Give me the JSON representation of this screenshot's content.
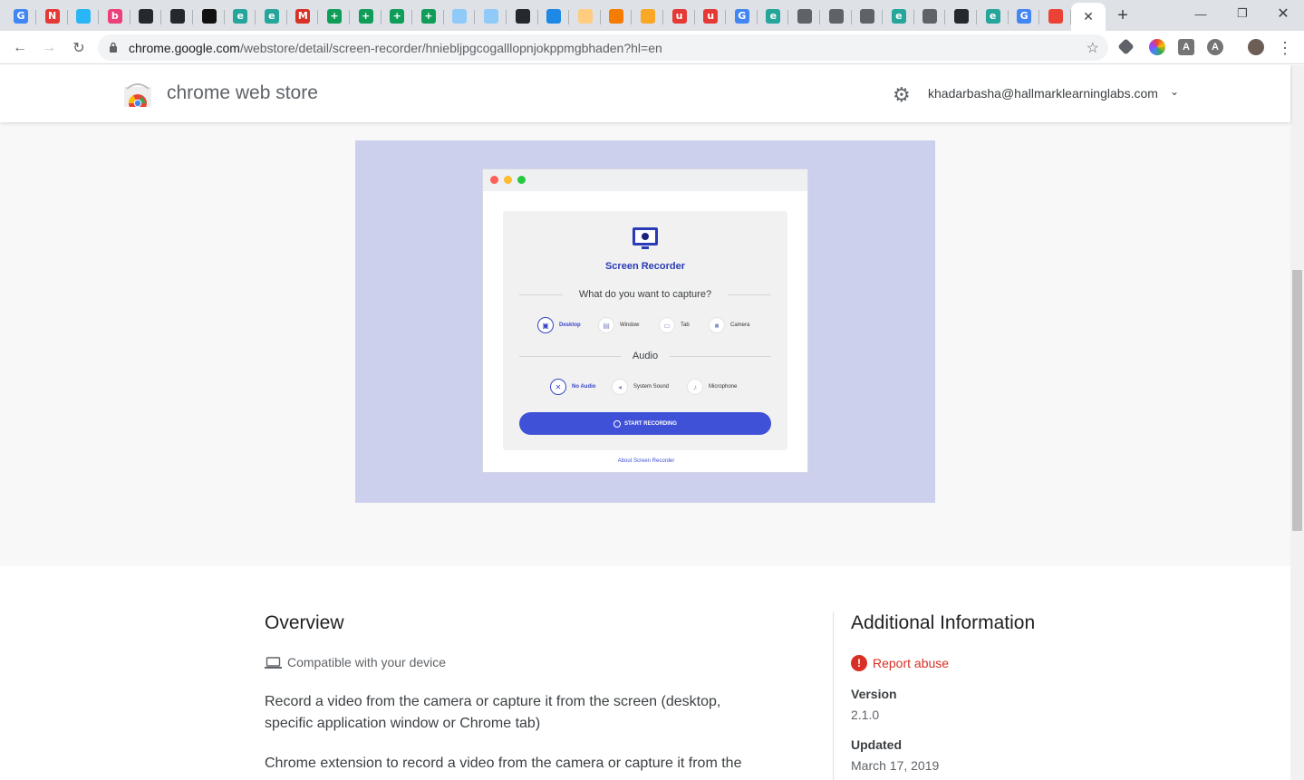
{
  "browser": {
    "tabs": [
      {
        "icon": "google-icon",
        "letter": "G",
        "color": "#4285f4"
      },
      {
        "icon": "n-icon",
        "letter": "N",
        "color": "#e53935"
      },
      {
        "icon": "pie-icon",
        "letter": "",
        "color": "#29b6f6"
      },
      {
        "icon": "b-icon",
        "letter": "b",
        "color": "#ec407a"
      },
      {
        "icon": "github-icon",
        "letter": "",
        "color": "#24292e"
      },
      {
        "icon": "github-icon",
        "letter": "",
        "color": "#24292e"
      },
      {
        "icon": "terminal-icon",
        "letter": "",
        "color": "#111111"
      },
      {
        "icon": "edu-icon",
        "letter": "e",
        "color": "#26a69a"
      },
      {
        "icon": "edu-icon",
        "letter": "e",
        "color": "#26a69a"
      },
      {
        "icon": "gmail-icon",
        "letter": "M",
        "color": "#d93025"
      },
      {
        "icon": "sheets-icon",
        "letter": "+",
        "color": "#0f9d58"
      },
      {
        "icon": "sheets-icon",
        "letter": "+",
        "color": "#0f9d58"
      },
      {
        "icon": "sheets-icon",
        "letter": "+",
        "color": "#0f9d58"
      },
      {
        "icon": "sheets-icon",
        "letter": "+",
        "color": "#0f9d58"
      },
      {
        "icon": "circle-icon",
        "letter": "",
        "color": "#90caf9"
      },
      {
        "icon": "circle-icon",
        "letter": "",
        "color": "#90caf9"
      },
      {
        "icon": "github-icon",
        "letter": "",
        "color": "#24292e"
      },
      {
        "icon": "person-icon",
        "letter": "",
        "color": "#1e88e5"
      },
      {
        "icon": "doc-icon",
        "letter": "",
        "color": "#ffcc80"
      },
      {
        "icon": "box-icon",
        "letter": "",
        "color": "#f57c00"
      },
      {
        "icon": "pma-icon",
        "letter": "",
        "color": "#f9a825"
      },
      {
        "icon": "u-icon",
        "letter": "u",
        "color": "#e53935"
      },
      {
        "icon": "u-icon",
        "letter": "u",
        "color": "#e53935"
      },
      {
        "icon": "translate-icon",
        "letter": "G",
        "color": "#4285f4"
      },
      {
        "icon": "edu-icon",
        "letter": "e",
        "color": "#26a69a"
      },
      {
        "icon": "globe-icon",
        "letter": "",
        "color": "#5f6368"
      },
      {
        "icon": "globe-icon",
        "letter": "",
        "color": "#5f6368"
      },
      {
        "icon": "globe-icon",
        "letter": "",
        "color": "#5f6368"
      },
      {
        "icon": "edu-icon",
        "letter": "e",
        "color": "#26a69a"
      },
      {
        "icon": "globe-icon",
        "letter": "",
        "color": "#5f6368"
      },
      {
        "icon": "github-icon",
        "letter": "",
        "color": "#24292e"
      },
      {
        "icon": "edu-icon",
        "letter": "e",
        "color": "#26a69a"
      },
      {
        "icon": "google-icon",
        "letter": "G",
        "color": "#4285f4"
      },
      {
        "icon": "webstore-icon",
        "letter": "",
        "color": "#ea4335"
      }
    ],
    "url_host": "chrome.google.com",
    "url_path": "/webstore/detail/screen-recorder/hnieblјpgcogalllopnjokppmgbhaden?hl=en"
  },
  "header": {
    "title": "chrome web store",
    "account": "khadarbasha@hallmarklearninglabs.com"
  },
  "preview": {
    "app_title": "Screen Recorder",
    "question": "What do you want to capture?",
    "capture_options": [
      "Desktop",
      "Window",
      "Tab",
      "Camera"
    ],
    "audio_heading": "Audio",
    "audio_options": [
      "No Audio",
      "System Sound",
      "Microphone"
    ],
    "start_button": "START RECORDING",
    "about_link": "About Screen Recorder"
  },
  "overview": {
    "title": "Overview",
    "compatible": "Compatible with your device",
    "desc1": "Record a video from the camera or capture it from the screen (desktop, specific application window or Chrome tab)",
    "desc2": "Chrome extension to record a video from the camera or capture it from the"
  },
  "additional": {
    "title": "Additional Information",
    "report": "Report abuse",
    "version_label": "Version",
    "version": "2.1.0",
    "updated_label": "Updated",
    "updated": "March 17, 2019"
  }
}
